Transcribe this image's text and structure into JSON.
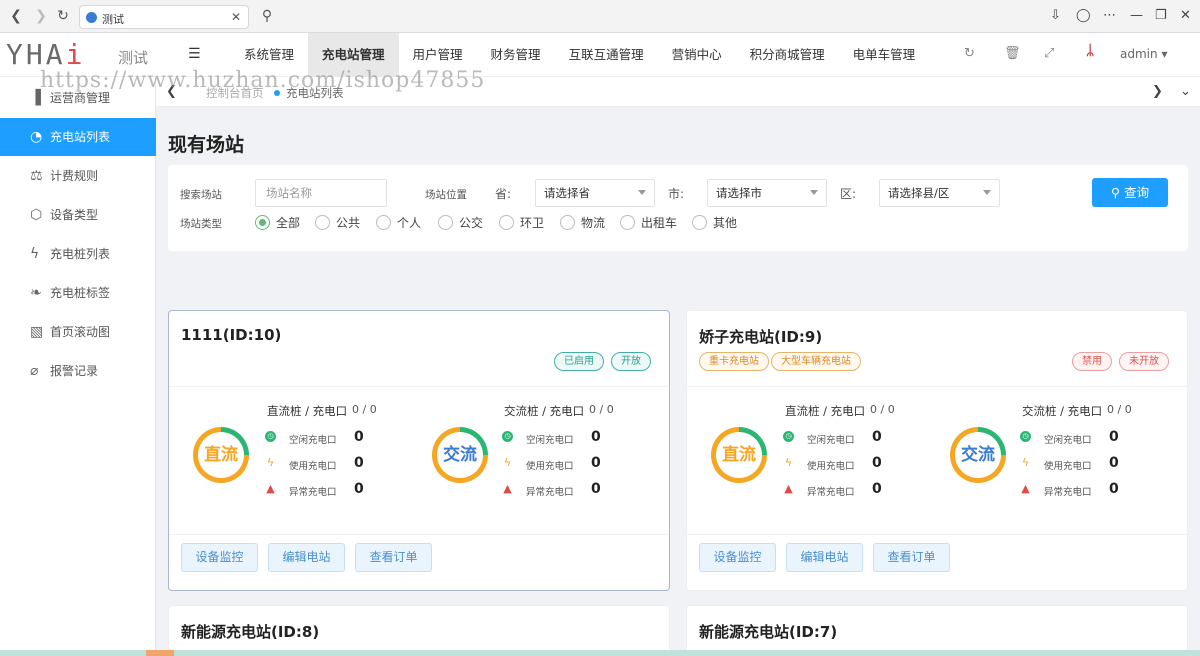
{
  "browser": {
    "tab_title": "测试"
  },
  "header": {
    "logo_text": "YHAi",
    "logo_sub": "测试",
    "nav": [
      "系统管理",
      "充电站管理",
      "用户管理",
      "财务管理",
      "互联互通管理",
      "营销中心",
      "积分商城管理",
      "电单车管理"
    ],
    "active_nav": "充电站管理",
    "user": "admin"
  },
  "watermark": "https://www.huzhan.com/ishop47855",
  "sidebar": {
    "items": [
      {
        "label": "运营商管理",
        "icon": "building-icon"
      },
      {
        "label": "充电站列表",
        "icon": "pie-chart-icon"
      },
      {
        "label": "计费规则",
        "icon": "scale-icon"
      },
      {
        "label": "设备类型",
        "icon": "cube-icon"
      },
      {
        "label": "充电桩列表",
        "icon": "bolt-icon"
      },
      {
        "label": "充电桩标签",
        "icon": "tag-icon"
      },
      {
        "label": "首页滚动图",
        "icon": "image-icon"
      },
      {
        "label": "报警记录",
        "icon": "bell-off-icon"
      }
    ],
    "active": "充电站列表"
  },
  "tabs": {
    "home": "控制台首页",
    "current": "充电站列表"
  },
  "page": {
    "title": "现有场站"
  },
  "filter": {
    "search_label": "搜索场站",
    "search_placeholder": "场站名称",
    "location_label": "场站位置",
    "province_label": "省:",
    "province_value": "请选择省",
    "city_label": "市:",
    "city_value": "请选择市",
    "district_label": "区:",
    "district_value": "请选择县/区",
    "type_label": "场站类型",
    "types": [
      "全部",
      "公共",
      "个人",
      "公交",
      "环卫",
      "物流",
      "出租车",
      "其他"
    ],
    "selected_type": "全部",
    "query_label": "查询"
  },
  "card_labels": {
    "dc_group": "直流桩 / 充电口",
    "ac_group": "交流桩 / 充电口",
    "dc_gauge": "直流",
    "ac_gauge": "交流",
    "idle": "空闲充电口",
    "in_use": "使用充电口",
    "abnormal": "异常充电口",
    "btn_monitor": "设备监控",
    "btn_edit": "编辑电站",
    "btn_orders": "查看订单"
  },
  "stations": [
    {
      "name": "1111(ID:10)",
      "left_tags": [],
      "right_tags": [
        "已启用",
        "开放"
      ],
      "dc_count": "0 / 0",
      "ac_count": "0 / 0",
      "dc": {
        "idle": "0",
        "in_use": "0",
        "abnormal": "0"
      },
      "ac": {
        "idle": "0",
        "in_use": "0",
        "abnormal": "0"
      }
    },
    {
      "name": "娇子充电站(ID:9)",
      "left_tags": [
        "重卡充电站",
        "大型车辆充电站"
      ],
      "right_tags": [
        "禁用",
        "未开放"
      ],
      "dc_count": "0 / 0",
      "ac_count": "0 / 0",
      "dc": {
        "idle": "0",
        "in_use": "0",
        "abnormal": "0"
      },
      "ac": {
        "idle": "0",
        "in_use": "0",
        "abnormal": "0"
      }
    },
    {
      "name": "新能源充电站(ID:8)"
    },
    {
      "name": "新能源充电站(ID:7)"
    }
  ]
}
